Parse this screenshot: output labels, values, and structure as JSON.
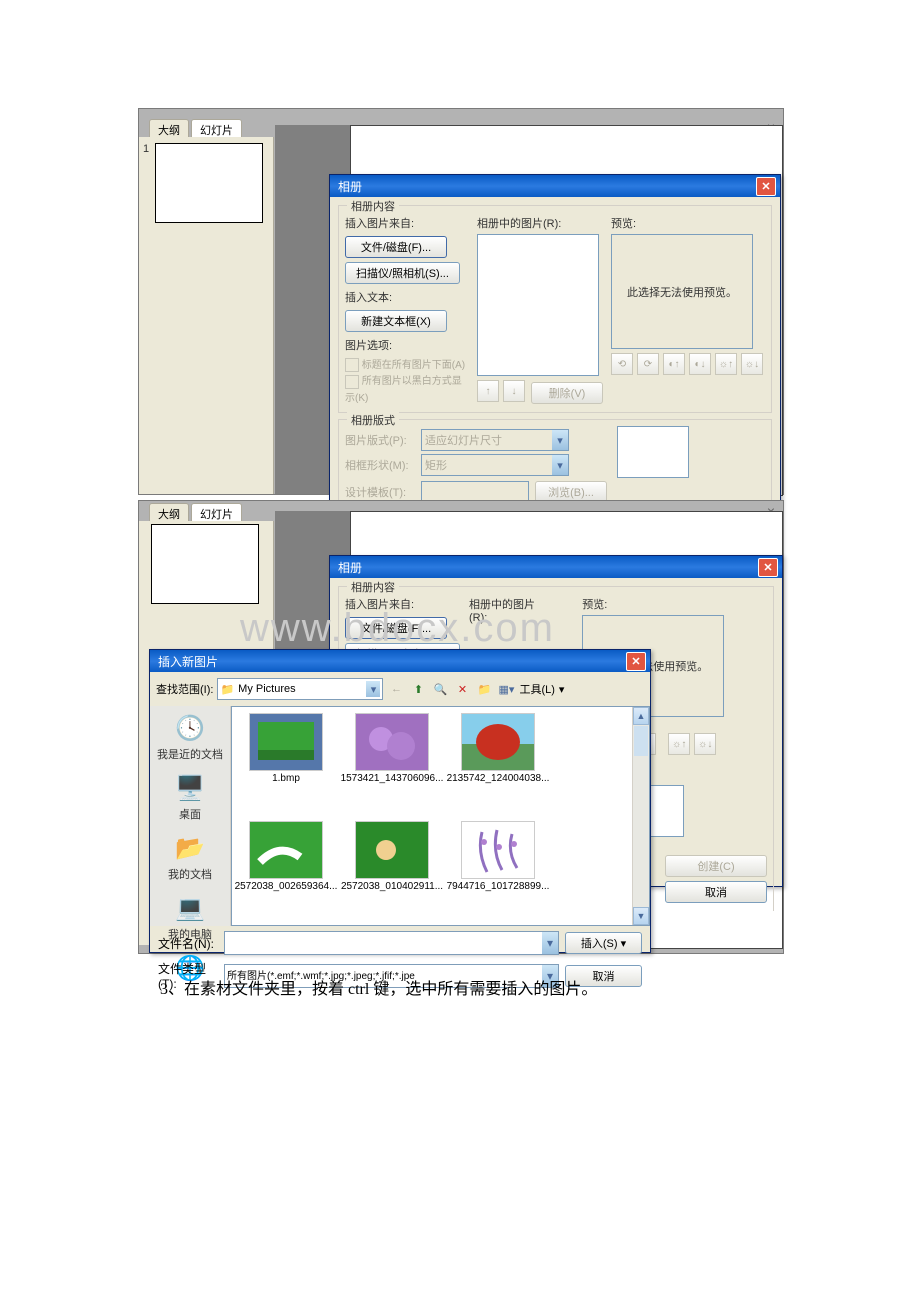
{
  "tabs": {
    "outline": "大纲",
    "slides": "幻灯片",
    "close": "×"
  },
  "slideNum": "1",
  "watermark": "www.bdocx.com",
  "bodyText": "3、在素材文件夹里，按着 ctrl 键，选中所有需要插入的图片。",
  "albumDialog": {
    "title": "相册",
    "content": "相册内容",
    "insertFrom": "插入图片来自:",
    "fileDisk": "文件/磁盘(F)...",
    "scanner": "扫描仪/照相机(S)...",
    "insertText": "插入文本:",
    "newTextbox": "新建文本框(X)",
    "picOptions": "图片选项:",
    "captionBelow": "标题在所有图片下面(A)",
    "blackWhite": "所有图片以黑白方式显示(K)",
    "picsInAlbum": "相册中的图片(R):",
    "preview": "预览:",
    "noPreview": "此选择无法使用预览。",
    "remove": "删除(V)",
    "layout": "相册版式",
    "picLayout": "图片版式(P):",
    "picLayoutVal": "适应幻灯片尺寸",
    "frameShape": "相框形状(M):",
    "frameShapeVal": "矩形",
    "designTemplate": "设计模板(T):",
    "browse": "浏览(B)...",
    "create": "创建(C)",
    "cancel": "取消",
    "up": "↑",
    "down": "↓"
  },
  "fileDialog": {
    "title": "插入新图片",
    "lookIn": "查找范围(I):",
    "folder": "My Pictures",
    "tools": "工具(L)",
    "places": {
      "recent": "我是近的文档",
      "desktop": "桌面",
      "mydocs": "我的文档",
      "mycomp": "我的电脑"
    },
    "files": [
      "1.bmp",
      "1573421_143706096...",
      "2135742_124004038...",
      "2572038_002659364...",
      "2572038_010402911...",
      "7944716_101728899..."
    ],
    "fileName": "文件名(N):",
    "fileType": "文件类型(T):",
    "fileTypeVal": "所有图片(*.emf;*.wmf;*.jpg;*.jpeg;*.jfif;*.jpe",
    "insert": "插入(S)",
    "cancel": "取消"
  }
}
